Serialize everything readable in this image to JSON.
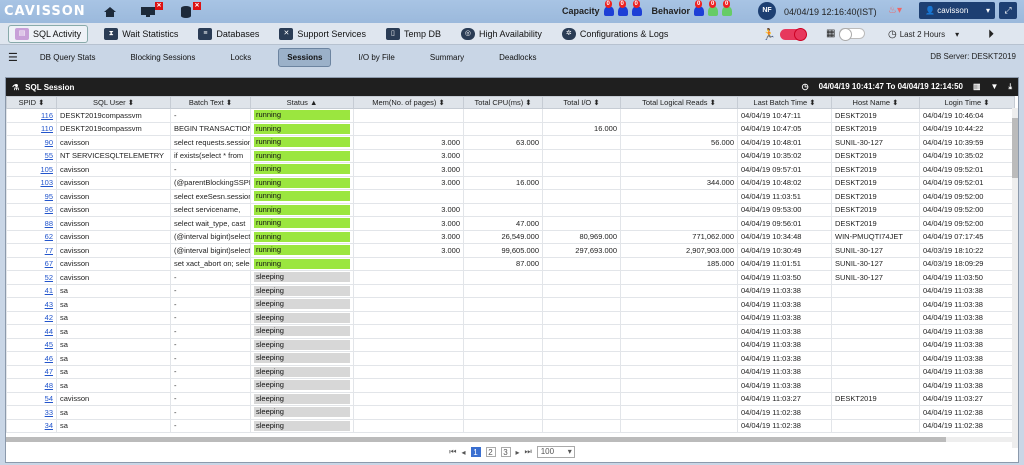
{
  "app": {
    "logo": "CAVISSON",
    "capacity_label": "Capacity",
    "behavior_label": "Behavior",
    "avatar_initials": "NF",
    "datetime": "04/04/19 12:16:40(IST)",
    "username": "cavisson",
    "capacity_counts": [
      "0",
      "0",
      "0"
    ],
    "behavior_counts": [
      "0",
      "0",
      "0"
    ],
    "capacity_colors": [
      "#1e3fd6",
      "#1e3fd6",
      "#1e3fd6"
    ],
    "behavior_colors": [
      "#1e3fd6",
      "#6c6",
      "#6c6"
    ]
  },
  "nav": {
    "items": [
      "SQL Activity",
      "Wait Statistics",
      "Databases",
      "Support Services",
      "Temp DB",
      "High Availability",
      "Configurations & Logs"
    ],
    "time_range": "Last 2 Hours"
  },
  "subnav": {
    "items": [
      "DB Query Stats",
      "Blocking Sessions",
      "Locks",
      "Sessions",
      "I/O by File",
      "Summary",
      "Deadlocks"
    ],
    "active": "Sessions",
    "db_server": "DB Server: DESKT2019"
  },
  "panel": {
    "title": "SQL Session",
    "range": "04/04/19 10:41:47 To 04/04/19 12:14:50"
  },
  "table": {
    "headers": [
      "SPID ⬍",
      "SQL User ⬍",
      "Batch Text ⬍",
      "Status ▲",
      "Mem(No. of pages) ⬍",
      "Total CPU(ms) ⬍",
      "Total I/O ⬍",
      "Total Logical Reads ⬍",
      "Last Batch Time ⬍",
      "Host Name ⬍",
      "Login Time ⬍"
    ],
    "rows": [
      [
        "116",
        "DESKT2019compassvm",
        "-",
        "running",
        "",
        "",
        "",
        "",
        "04/04/19 10:47:11",
        "DESKT2019",
        "04/04/19 10:46:04"
      ],
      [
        "110",
        "DESKT2019compassvm",
        "BEGIN TRANSACTION",
        "running",
        "",
        "",
        "16.000",
        "",
        "04/04/19 10:47:05",
        "DESKT2019",
        "04/04/19 10:44:22"
      ],
      [
        "90",
        "cavisson",
        "select requests.session",
        "running",
        "3.000",
        "63.000",
        "",
        "56.000",
        "04/04/19 10:48:01",
        "SUNIL-30-127",
        "04/04/19 10:39:59"
      ],
      [
        "55",
        "NT SERVICESQLTELEMETRY",
        "if exists(select * from",
        "running",
        "3.000",
        "",
        "",
        "",
        "04/04/19 10:35:02",
        "DESKT2019",
        "04/04/19 10:35:02"
      ],
      [
        "105",
        "cavisson",
        "-",
        "running",
        "3.000",
        "",
        "",
        "",
        "04/04/19 09:57:01",
        "DESKT2019",
        "04/04/19 09:52:01"
      ],
      [
        "103",
        "cavisson",
        "(@parentBlockingSSPID",
        "running",
        "3.000",
        "16.000",
        "",
        "344.000",
        "04/04/19 10:48:02",
        "DESKT2019",
        "04/04/19 09:52:01"
      ],
      [
        "95",
        "cavisson",
        "select exeSesn.session",
        "running",
        "",
        "",
        "",
        "",
        "04/04/19 11:03:51",
        "DESKT2019",
        "04/04/19 09:52:00"
      ],
      [
        "96",
        "cavisson",
        "select servicename,",
        "running",
        "3.000",
        "",
        "",
        "",
        "04/04/19 09:53:00",
        "DESKT2019",
        "04/04/19 09:52:00"
      ],
      [
        "88",
        "cavisson",
        "select wait_type, cast",
        "running",
        "3.000",
        "47.000",
        "",
        "",
        "04/04/19 09:56:01",
        "DESKT2019",
        "04/04/19 09:52:00"
      ],
      [
        "62",
        "cavisson",
        "(@interval bigint)select",
        "running",
        "3.000",
        "26,549.000",
        "80,969.000",
        "771,062.000",
        "04/04/19 10:34:48",
        "WIN-PMUQTI74JET",
        "04/04/19 07:17:45"
      ],
      [
        "77",
        "cavisson",
        "(@interval bigint)select",
        "running",
        "3.000",
        "99,605.000",
        "297,693.000",
        "2,907,903.000",
        "04/04/19 10:30:49",
        "SUNIL-30-127",
        "04/03/19 18:10:22"
      ],
      [
        "67",
        "cavisson",
        "set xact_abort on; select",
        "running",
        "",
        "87.000",
        "",
        "185.000",
        "04/04/19 11:01:51",
        "SUNIL-30-127",
        "04/03/19 18:09:29"
      ],
      [
        "52",
        "cavisson",
        "-",
        "sleeping",
        "",
        "",
        "",
        "",
        "04/04/19 11:03:50",
        "SUNIL-30-127",
        "04/04/19 11:03:50"
      ],
      [
        "41",
        "sa",
        "-",
        "sleeping",
        "",
        "",
        "",
        "",
        "04/04/19 11:03:38",
        "",
        "04/04/19 11:03:38"
      ],
      [
        "43",
        "sa",
        "-",
        "sleeping",
        "",
        "",
        "",
        "",
        "04/04/19 11:03:38",
        "",
        "04/04/19 11:03:38"
      ],
      [
        "42",
        "sa",
        "-",
        "sleeping",
        "",
        "",
        "",
        "",
        "04/04/19 11:03:38",
        "",
        "04/04/19 11:03:38"
      ],
      [
        "44",
        "sa",
        "-",
        "sleeping",
        "",
        "",
        "",
        "",
        "04/04/19 11:03:38",
        "",
        "04/04/19 11:03:38"
      ],
      [
        "45",
        "sa",
        "-",
        "sleeping",
        "",
        "",
        "",
        "",
        "04/04/19 11:03:38",
        "",
        "04/04/19 11:03:38"
      ],
      [
        "46",
        "sa",
        "-",
        "sleeping",
        "",
        "",
        "",
        "",
        "04/04/19 11:03:38",
        "",
        "04/04/19 11:03:38"
      ],
      [
        "47",
        "sa",
        "-",
        "sleeping",
        "",
        "",
        "",
        "",
        "04/04/19 11:03:38",
        "",
        "04/04/19 11:03:38"
      ],
      [
        "48",
        "sa",
        "-",
        "sleeping",
        "",
        "",
        "",
        "",
        "04/04/19 11:03:38",
        "",
        "04/04/19 11:03:38"
      ],
      [
        "54",
        "cavisson",
        "-",
        "sleeping",
        "",
        "",
        "",
        "",
        "04/04/19 11:03:27",
        "DESKT2019",
        "04/04/19 11:03:27"
      ],
      [
        "33",
        "sa",
        "-",
        "sleeping",
        "",
        "",
        "",
        "",
        "04/04/19 11:02:38",
        "",
        "04/04/19 11:02:38"
      ],
      [
        "34",
        "sa",
        "-",
        "sleeping",
        "",
        "",
        "",
        "",
        "04/04/19 11:02:38",
        "",
        "04/04/19 11:02:38"
      ]
    ]
  },
  "pager": {
    "pages": [
      "1",
      "2",
      "3"
    ],
    "page_size": "100"
  }
}
